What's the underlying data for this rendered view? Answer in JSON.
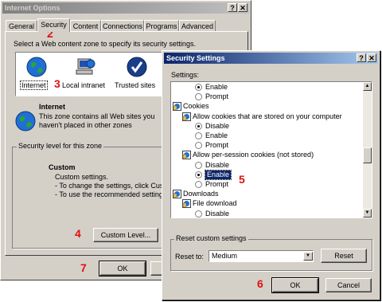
{
  "internet_options": {
    "title": "Internet Options",
    "tabs": [
      "General",
      "Security",
      "Content",
      "Connections",
      "Programs",
      "Advanced"
    ],
    "instruction": "Select a Web content zone to specify its security settings.",
    "zones": [
      "Internet",
      "Local intranet",
      "Trusted sites"
    ],
    "zone_title": "Internet",
    "zone_desc_1": "This zone contains all Web sites you",
    "zone_desc_2": "haven't placed in other zones",
    "security_level_label": "Security level for this zone",
    "custom_title": "Custom",
    "custom_line_1": "Custom settings.",
    "custom_line_2": "- To change the settings, click Cust",
    "custom_line_3": "- To use the recommended settings,",
    "custom_level_button": "Custom Level...",
    "ok_button": "OK"
  },
  "security_settings": {
    "title": "Security Settings",
    "settings_label": "Settings:",
    "items": [
      {
        "kind": "radio",
        "label": "Enable",
        "checked": true
      },
      {
        "kind": "radio",
        "label": "Prompt",
        "checked": false
      },
      {
        "kind": "category",
        "label": "Cookies"
      },
      {
        "kind": "setting",
        "label": "Allow cookies that are stored on your computer"
      },
      {
        "kind": "radio",
        "label": "Disable",
        "checked": true
      },
      {
        "kind": "radio",
        "label": "Enable",
        "checked": false
      },
      {
        "kind": "radio",
        "label": "Prompt",
        "checked": false
      },
      {
        "kind": "setting",
        "label": "Allow per-session cookies (not stored)"
      },
      {
        "kind": "radio",
        "label": "Disable",
        "checked": false
      },
      {
        "kind": "radio",
        "label": "Enable",
        "checked": true,
        "selected": true
      },
      {
        "kind": "radio",
        "label": "Prompt",
        "checked": false
      },
      {
        "kind": "category",
        "label": "Downloads"
      },
      {
        "kind": "setting",
        "label": "File download"
      },
      {
        "kind": "radio",
        "label": "Disable",
        "checked": false
      }
    ],
    "reset_group_label": "Reset custom settings",
    "reset_to_label": "Reset to:",
    "reset_to_value": "Medium",
    "reset_button": "Reset",
    "ok_button": "OK",
    "cancel_button": "Cancel"
  },
  "annotations": {
    "n2": "2",
    "n3": "3",
    "n4": "4",
    "n5": "5",
    "n6": "6",
    "n7": "7"
  },
  "colors": {
    "title_active": "#0a246a",
    "title_inactive": "#808080",
    "annotation": "#e01010",
    "selection": "#0a246a"
  }
}
